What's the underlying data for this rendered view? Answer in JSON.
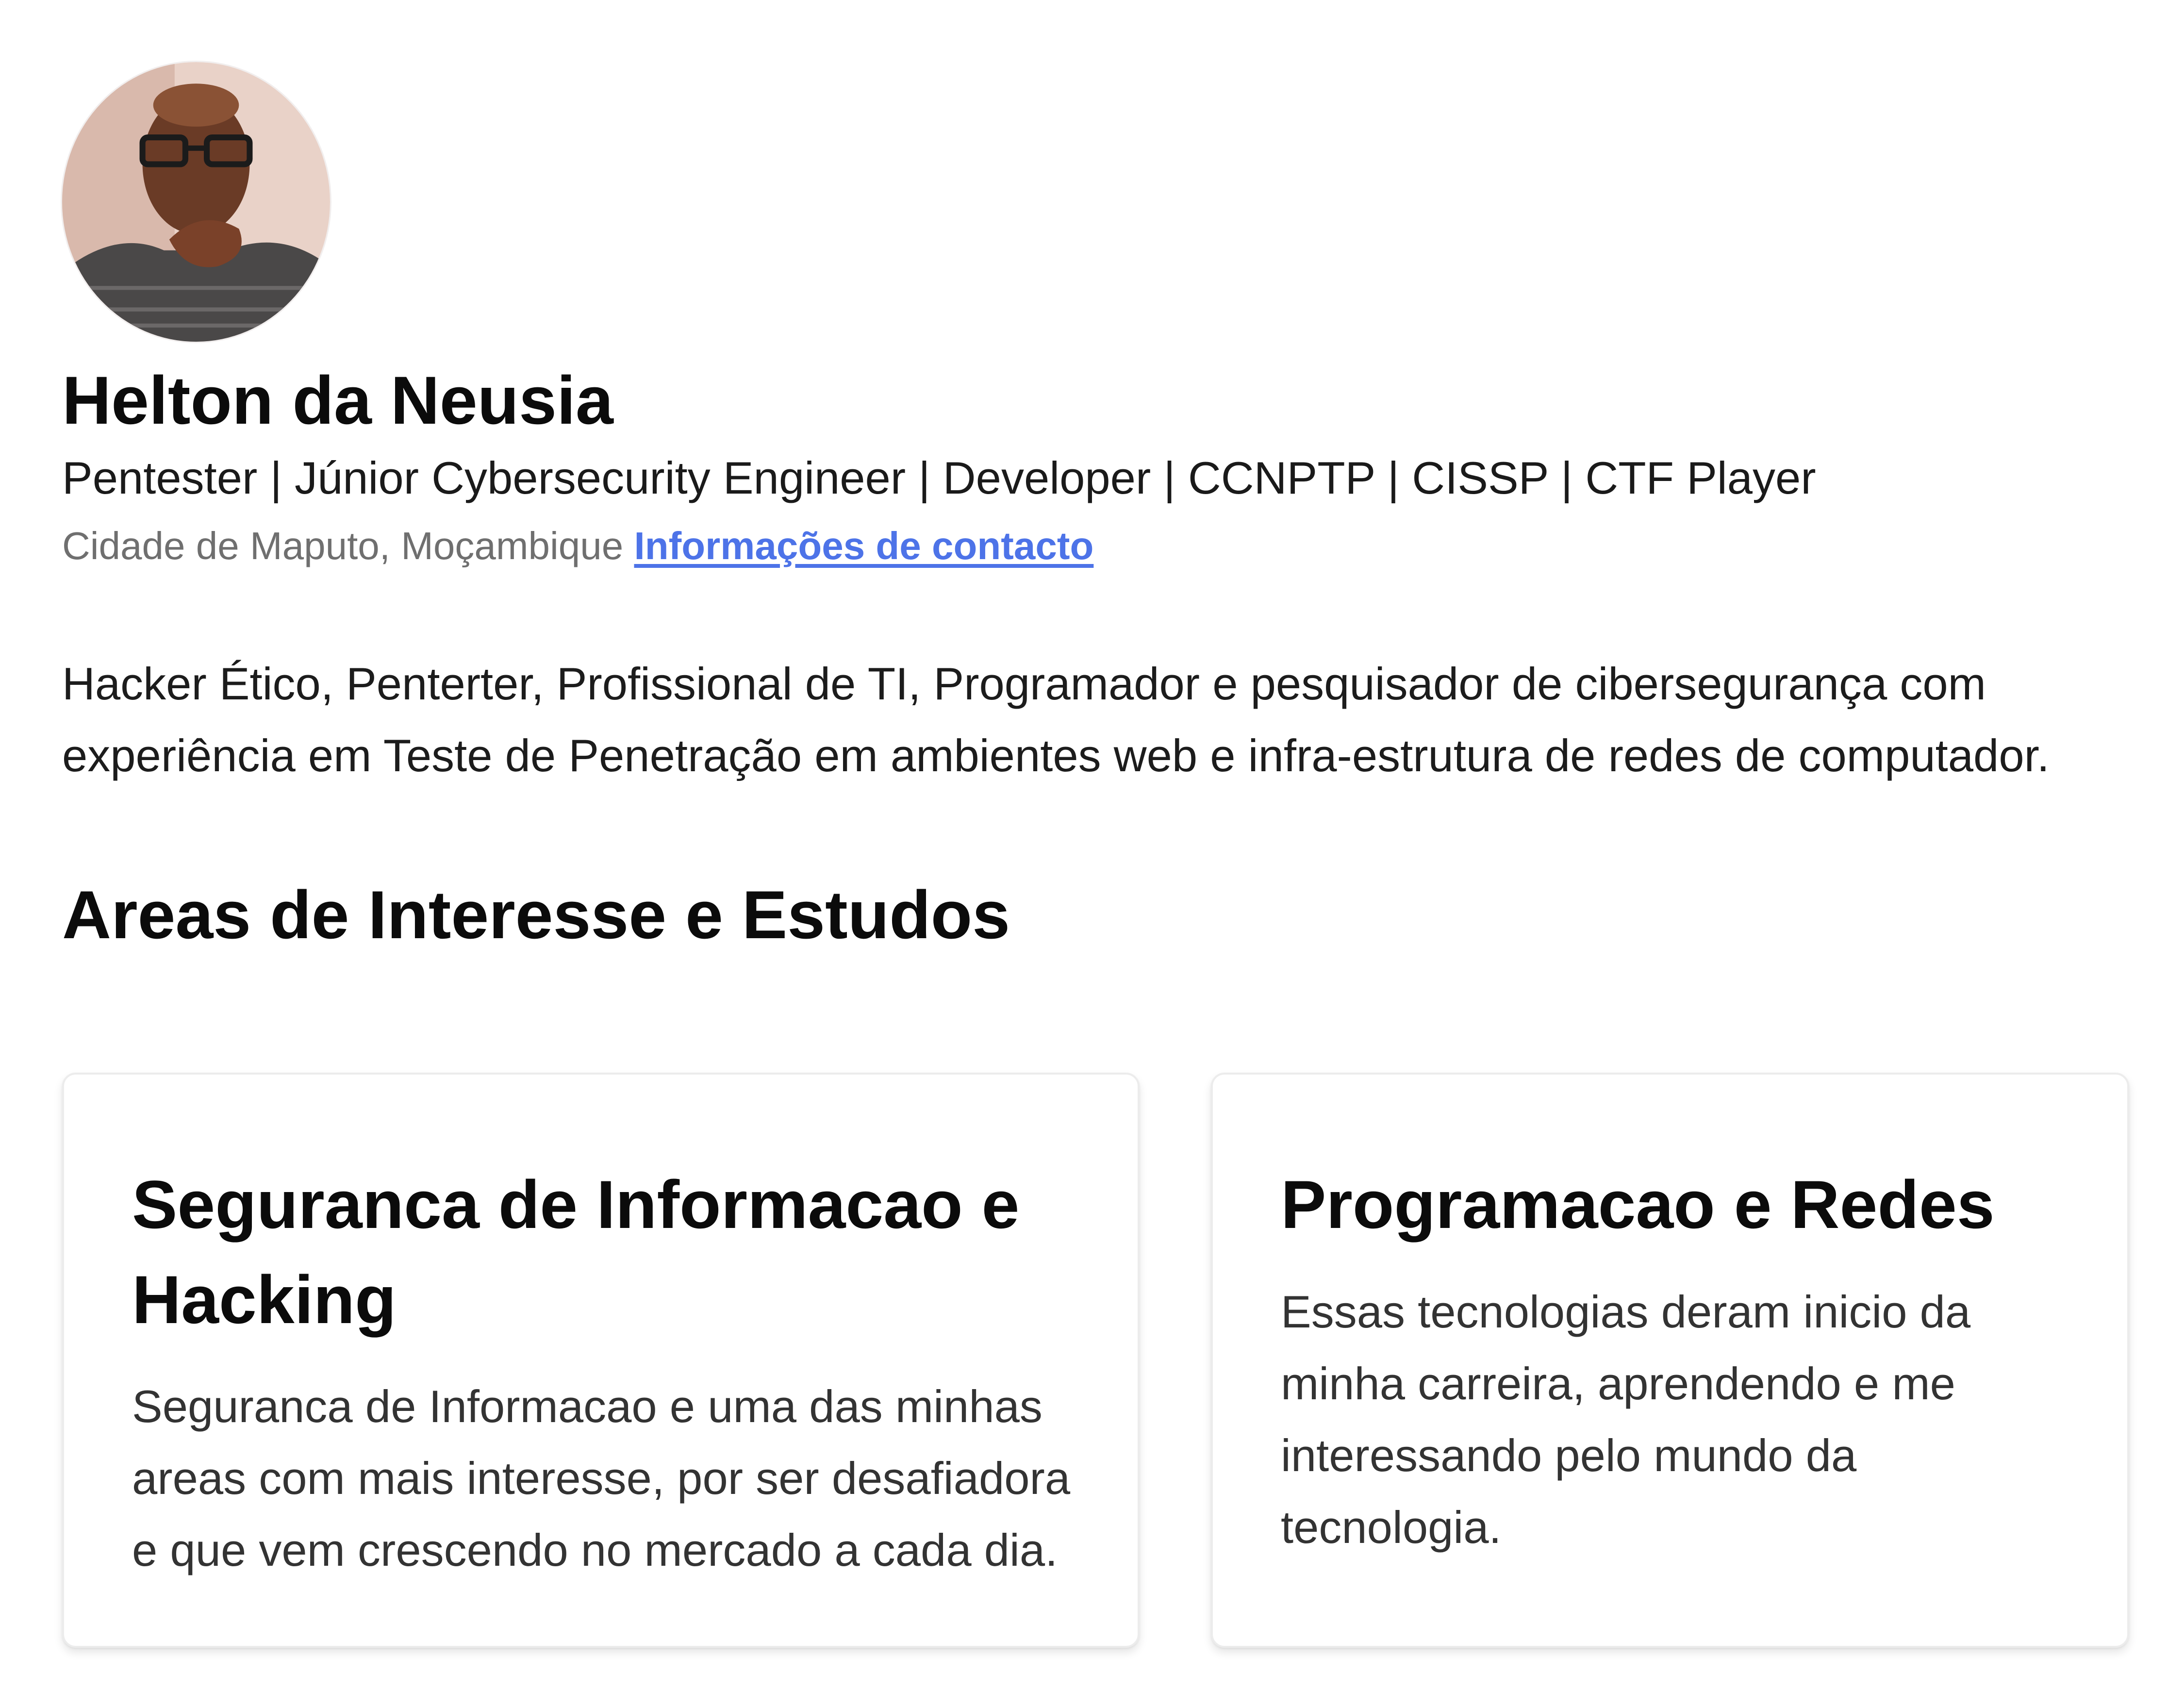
{
  "profile": {
    "name": "Helton da Neusia",
    "headline": "Pentester | Júnior Cybersecurity Engineer | Developer | CCNPTP | CISSP | CTF Player",
    "location": "Cidade de Maputo, Moçambique",
    "contact_link": "Informações de contacto",
    "bio": "Hacker Ético, Penterter, Profissional de TI, Programador e pesquisador de cibersegurança com experiência em Teste de Penetração em ambientes web e infra-estrutura de redes de computador."
  },
  "interests": {
    "title": "Areas de Interesse e Estudos",
    "cards": [
      {
        "title": "Seguranca de Informacao e Hacking",
        "text": "Seguranca de Informacao e uma das minhas areas com mais interesse, por ser desafiadora e que vem crescendo no mercado a cada dia."
      },
      {
        "title": "Programacao e Redes",
        "text": "Essas tecnologias deram inicio da minha carreira, aprendendo e me interessando pelo mundo da tecnologia."
      }
    ]
  },
  "colors": {
    "link": "#4d73e8",
    "text": "#111111",
    "muted": "#6f6f6f",
    "card_border": "#ececec"
  }
}
